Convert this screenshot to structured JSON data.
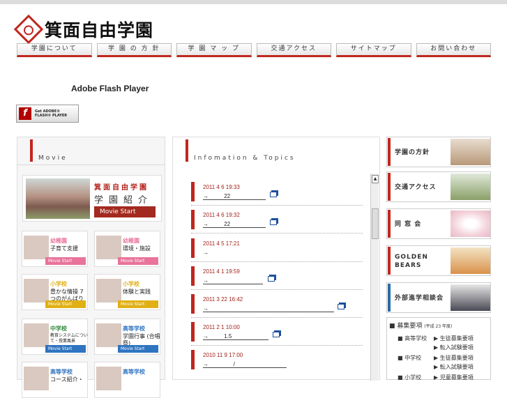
{
  "header": {
    "title": "箕面自由学園"
  },
  "nav": [
    "学園について",
    "学 園 の 方 針",
    "学 園 マ ッ プ",
    "交通アクセス",
    "サイトマップ",
    "お問い合わせ"
  ],
  "flash": {
    "title": "Adobe Flash Player",
    "badge_line1": "Get ADOBE®",
    "badge_line2": "FLASH® PLAYER"
  },
  "movie": {
    "heading": "Movie",
    "feature": {
      "title": "箕面自由学園",
      "subtitle": "学園紹介",
      "button": "Movie Start"
    },
    "tiles": [
      {
        "kind": "幼稚園",
        "caption": "子育て支援",
        "button": "Movie Start",
        "color": "#e8739b"
      },
      {
        "kind": "幼稚園",
        "caption": "環境・施設",
        "button": "Movie Start",
        "color": "#e8739b"
      },
      {
        "kind": "小学校",
        "caption": "豊かな情操 7つのがんばり",
        "button": "Movie Start",
        "color": "#e0b015"
      },
      {
        "kind": "小学校",
        "caption": "体験と実践",
        "button": "Movie Start",
        "color": "#e0b015"
      },
      {
        "kind": "中学校",
        "caption": "教育システムについて・授業風景",
        "button": "Movie Start",
        "color": "#2f8a3a"
      },
      {
        "kind": "高等学校",
        "caption": "学園行事 (合唱祭)",
        "button": "Movie Start",
        "color": "#2f74c0"
      },
      {
        "kind": "高等学校",
        "caption": "コース紹介・",
        "button": "Movie Start",
        "color": "#2f74c0"
      },
      {
        "kind": "高等学校",
        "caption": "",
        "button": "Movie Start",
        "color": "#2f74c0"
      }
    ]
  },
  "topics": {
    "heading": "Infomation & Topics",
    "items": [
      {
        "date": "2011 4 6 19:33",
        "text": "→          22"
      },
      {
        "date": "2011 4 6 19:32",
        "text": "→          22"
      },
      {
        "date": "2011 4 5 17:21",
        "text": "→"
      },
      {
        "date": "2011 4 1 19:59",
        "text": "→"
      },
      {
        "date": "2011 3 22 16:42",
        "text": "→"
      },
      {
        "date": "2011 2 1 10:00",
        "text": "→          1.5"
      },
      {
        "date": "2010 11 9 17:00",
        "text": "→                /"
      }
    ]
  },
  "right": {
    "buttons": [
      "学園の方針",
      "交通アクセス",
      "同 窓 会",
      "GOLDEN BEARS",
      "外部進学相談会"
    ],
    "boshu": {
      "title": "募集要項",
      "year": "(平成 23 年度)",
      "rows": [
        {
          "school": "■ 高等学校",
          "item": "▶ 生徒募集要項"
        },
        {
          "school": "",
          "item": "▶ 転入試験要項"
        },
        {
          "school": "■ 中学校",
          "item": "▶ 生徒募集要項"
        },
        {
          "school": "",
          "item": "▶ 転入試験要項"
        },
        {
          "school": "■ 小学校",
          "item": "▶ 児童募集要項"
        }
      ]
    }
  }
}
